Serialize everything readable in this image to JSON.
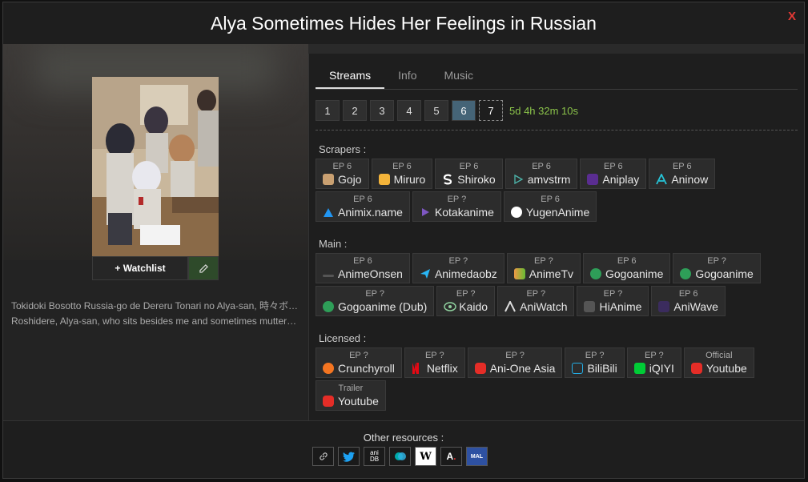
{
  "title": "Alya Sometimes Hides Her Feelings in Russian",
  "close_label": "X",
  "poster": {
    "watchlist_label": "+ Watchlist",
    "edit_icon": "pencil-icon"
  },
  "synopsis": [
    "Tokidoki Bosotto Russia-go de Dereru Tonari no Alya-san, 時々ボソッとロシア語でデレる隣のアーリャさん",
    "Roshidere, Alya-san, who sits besides me and sometimes mutters sweet nothings in Russian"
  ],
  "tabs": [
    "Streams",
    "Info",
    "Music"
  ],
  "episodes": [
    "1",
    "2",
    "3",
    "4",
    "5",
    "6",
    "7"
  ],
  "countdown": "5d 4h 32m 10s",
  "sections": {
    "scrapers_label": "Scrapers :",
    "main_label": "Main :",
    "licensed_label": "Licensed :"
  },
  "scrapers": [
    {
      "ep": "EP 6",
      "name": "Gojo",
      "icon": "gojo-icon"
    },
    {
      "ep": "EP 6",
      "name": "Miruro",
      "icon": "miruro-icon"
    },
    {
      "ep": "EP 6",
      "name": "Shiroko",
      "icon": "shiroko-icon"
    },
    {
      "ep": "EP 6",
      "name": "amvstrm",
      "icon": "play-icon"
    },
    {
      "ep": "EP 6",
      "name": "Aniplay",
      "icon": "aniplay-icon"
    },
    {
      "ep": "EP 6",
      "name": "Aninow",
      "icon": "aninow-icon"
    },
    {
      "ep": "EP 6",
      "name": "Animix.name",
      "icon": "animix-icon"
    },
    {
      "ep": "EP ?",
      "name": "Kotakanime",
      "icon": "kotakanime-icon"
    },
    {
      "ep": "EP 6",
      "name": "YugenAnime",
      "icon": "yugenanime-icon"
    }
  ],
  "main": [
    {
      "ep": "EP 6",
      "name": "AnimeOnsen",
      "icon": "animeonsen-icon"
    },
    {
      "ep": "EP ?",
      "name": "Animedaobz",
      "icon": "animedaobz-icon"
    },
    {
      "ep": "EP ?",
      "name": "AnimeTv",
      "icon": "animetv-icon"
    },
    {
      "ep": "EP 6",
      "name": "Gogoanime",
      "icon": "gogoanime-icon"
    },
    {
      "ep": "EP ?",
      "name": "Gogoanime",
      "icon": "gogoanime-icon"
    },
    {
      "ep": "EP ?",
      "name": "Gogoanime (Dub)",
      "icon": "gogoanime-icon"
    },
    {
      "ep": "EP ?",
      "name": "Kaido",
      "icon": "kaido-icon"
    },
    {
      "ep": "EP ?",
      "name": "AniWatch",
      "icon": "aniwatch-icon"
    },
    {
      "ep": "EP ?",
      "name": "HiAnime",
      "icon": "hianime-icon"
    },
    {
      "ep": "EP 6",
      "name": "AniWave",
      "icon": "aniwave-icon"
    }
  ],
  "licensed": [
    {
      "ep": "EP ?",
      "name": "Crunchyroll",
      "icon": "crunchyroll-icon"
    },
    {
      "ep": "EP ?",
      "name": "Netflix",
      "icon": "netflix-icon"
    },
    {
      "ep": "EP ?",
      "name": "Ani-One Asia",
      "icon": "youtube-icon"
    },
    {
      "ep": "EP ?",
      "name": "BiliBili",
      "icon": "bilibili-icon"
    },
    {
      "ep": "EP ?",
      "name": "iQIYI",
      "icon": "iqiyi-icon"
    },
    {
      "ep": "Official",
      "name": "Youtube",
      "icon": "youtube-icon"
    },
    {
      "ep": "Trailer",
      "name": "Youtube",
      "icon": "youtube-icon"
    }
  ],
  "other_resources_label": "Other resources :",
  "resources": [
    "link-icon",
    "twitter-icon",
    "anidb-icon",
    "anilist-icon",
    "wikipedia-icon",
    "anime-planet-icon",
    "myanimelist-icon"
  ],
  "resource_texts": {
    "anidb": "ani DB",
    "mal": "MAL"
  },
  "colors": {
    "accent": "#456477",
    "countdown": "#8bc34a",
    "close": "#e53935"
  }
}
